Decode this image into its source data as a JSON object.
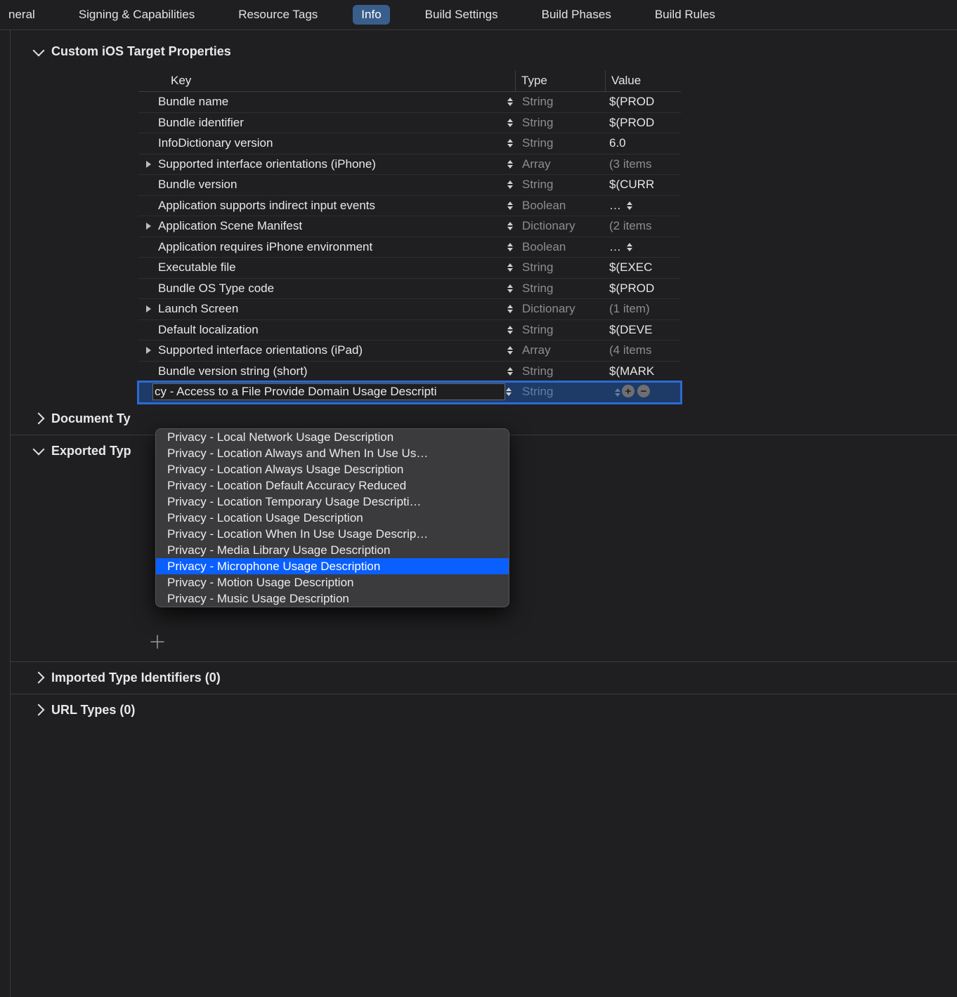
{
  "tabs": [
    "neral",
    "Signing & Capabilities",
    "Resource Tags",
    "Info",
    "Build Settings",
    "Build Phases",
    "Build Rules"
  ],
  "tabs_selected_index": 3,
  "section1_title": "Custom iOS Target Properties",
  "columns": {
    "key": "Key",
    "type": "Type",
    "value": "Value"
  },
  "rows": [
    {
      "exp": false,
      "key": "Bundle name",
      "type": "String",
      "value": "$(PROD"
    },
    {
      "exp": false,
      "key": "Bundle identifier",
      "type": "String",
      "value": "$(PROD"
    },
    {
      "exp": false,
      "key": "InfoDictionary version",
      "type": "String",
      "value": "6.0"
    },
    {
      "exp": true,
      "key": "Supported interface orientations (iPhone)",
      "type": "Array",
      "value": "(3 items"
    },
    {
      "exp": false,
      "key": "Bundle version",
      "type": "String",
      "value": "$(CURR"
    },
    {
      "exp": false,
      "key": "Application supports indirect input events",
      "type": "Boolean",
      "value": "…",
      "valStepper": true
    },
    {
      "exp": true,
      "key": "Application Scene Manifest",
      "type": "Dictionary",
      "value": "(2 items"
    },
    {
      "exp": false,
      "key": "Application requires iPhone environment",
      "type": "Boolean",
      "value": "…",
      "valStepper": true
    },
    {
      "exp": false,
      "key": "Executable file",
      "type": "String",
      "value": "$(EXEC"
    },
    {
      "exp": false,
      "key": "Bundle OS Type code",
      "type": "String",
      "value": "$(PROD"
    },
    {
      "exp": true,
      "key": "Launch Screen",
      "type": "Dictionary",
      "value": "(1 item)"
    },
    {
      "exp": false,
      "key": "Default localization",
      "type": "String",
      "value": "$(DEVE"
    },
    {
      "exp": true,
      "key": "Supported interface orientations (iPad)",
      "type": "Array",
      "value": "(4 items"
    },
    {
      "exp": false,
      "key": "Bundle version string (short)",
      "type": "String",
      "value": "$(MARK"
    }
  ],
  "edit_row": {
    "key": "cy - Access to a File Provide Domain Usage Descripti",
    "type": "String"
  },
  "dropdown_items": [
    "Privacy - Local Network Usage Description",
    "Privacy - Location Always and When In Use Us…",
    "Privacy - Location Always Usage Description",
    "Privacy - Location Default Accuracy Reduced",
    "Privacy - Location Temporary Usage Descripti…",
    "Privacy - Location Usage Description",
    "Privacy - Location When In Use Usage Descrip…",
    "Privacy - Media Library Usage Description",
    "Privacy - Microphone Usage Description",
    "Privacy - Motion Usage Description",
    "Privacy - Music Usage Description"
  ],
  "dropdown_highlight_index": 8,
  "section_document_types": "Document Ty",
  "section_exported_types": "Exported Typ",
  "section_imported": "Imported Type Identifiers (0)",
  "section_url_types": "URL Types (0)"
}
